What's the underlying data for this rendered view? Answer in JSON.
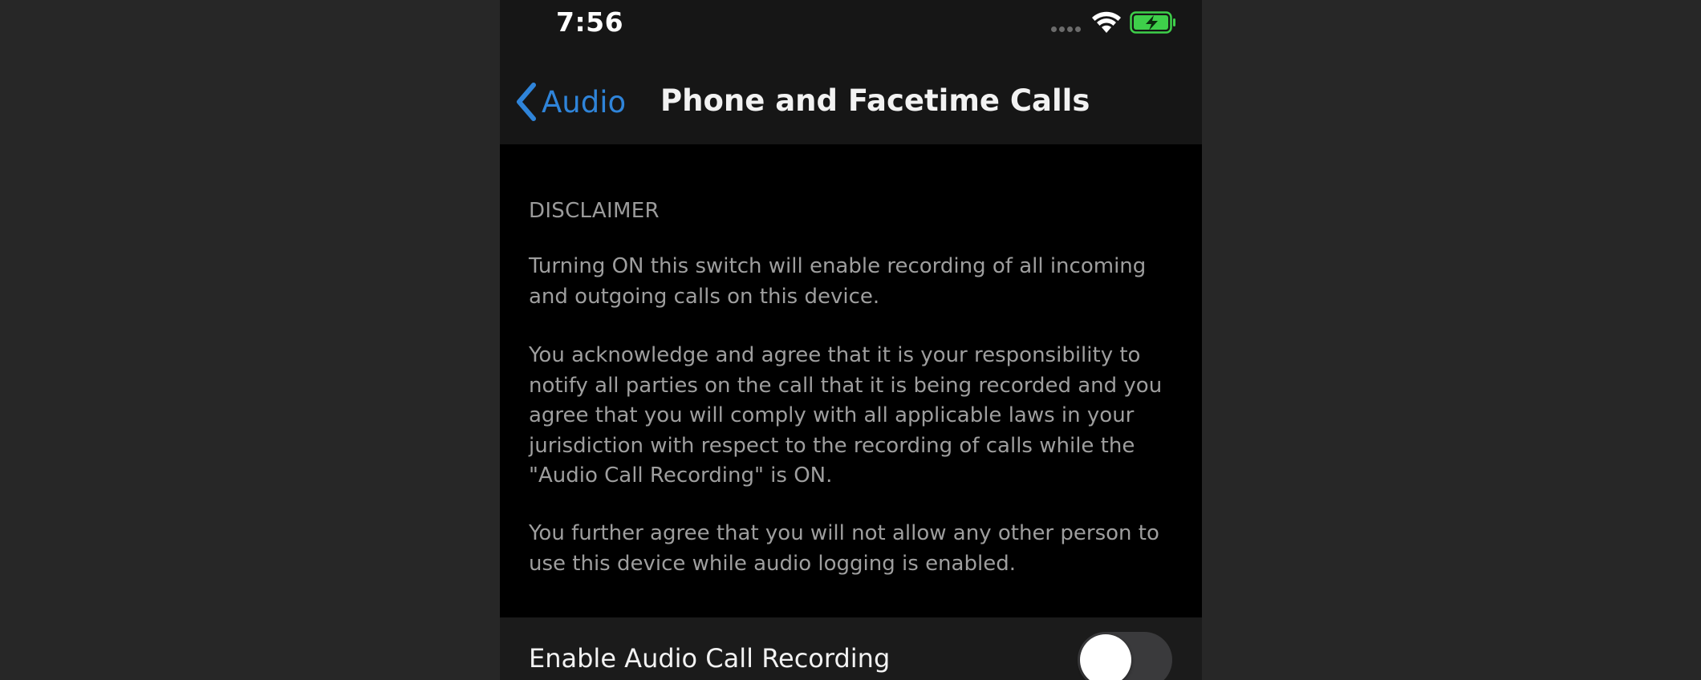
{
  "status_bar": {
    "time": "7:56",
    "signal_icon": "cellular-signal-icon",
    "wifi_icon": "wifi-icon",
    "battery_icon": "battery-charging-icon",
    "battery_color": "#3ecf4a"
  },
  "nav": {
    "back_label": "Audio",
    "title": "Phone and Facetime Calls",
    "accent_color": "#2f84d9"
  },
  "disclaimer": {
    "header": "DISCLAIMER",
    "paragraph_1": "Turning ON this switch will enable recording of all incoming and outgoing calls on this device.",
    "paragraph_2": "You acknowledge and agree that it is your responsibility to notify all parties on the call that it is being recorded and you agree that you will comply with all applicable laws in your jurisdiction with respect to the recording of calls while the \"Audio Call Recording\" is ON.",
    "paragraph_3": "You further agree that you will not allow any other person to use this device while audio logging is enabled."
  },
  "setting": {
    "label": "Enable Audio Call Recording",
    "enabled": false
  }
}
